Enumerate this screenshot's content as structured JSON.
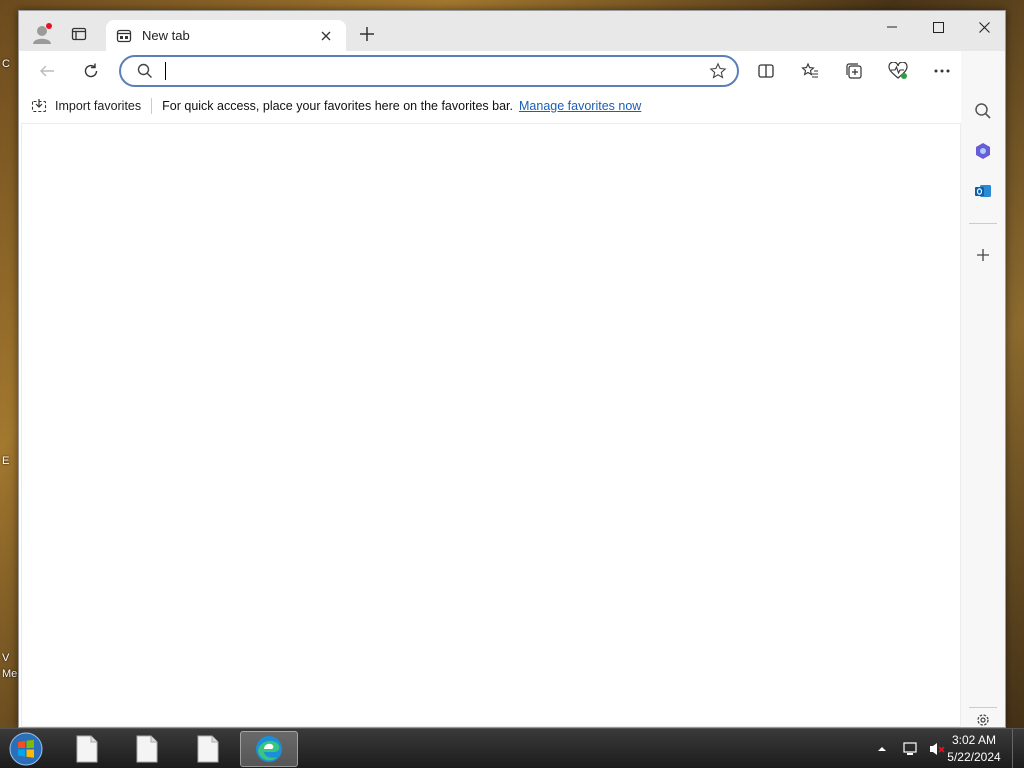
{
  "desktop": {
    "labels": [
      "C",
      "E",
      "V",
      "Me"
    ]
  },
  "browser": {
    "tab": {
      "title": "New tab"
    },
    "address_bar": {
      "value": "",
      "placeholder": ""
    },
    "favorites_bar": {
      "import_label": "Import favorites",
      "message": "For quick access, place your favorites here on the favorites bar.",
      "manage_link": "Manage favorites now"
    },
    "icons": {
      "profile": "profile-icon",
      "tab_actions": "tab-actions-icon",
      "new_tab": "plus-icon",
      "back": "back-arrow-icon",
      "refresh": "refresh-icon",
      "search": "search-icon",
      "favorite": "star-icon",
      "split_screen": "split-screen-icon",
      "favorites": "favorites-icon",
      "collections": "collections-icon",
      "performance": "heartbeat-icon",
      "more": "more-icon",
      "copilot": "copilot-icon"
    },
    "sidebar": [
      "search-icon",
      "copilot-app-icon",
      "outlook-icon",
      "add-icon",
      "settings-icon"
    ]
  },
  "colors": {
    "accent": "#1a5fb4",
    "address_border": "#5b7fb8",
    "titlebar": "#e8e8e8",
    "notification_dot": "#e81123"
  },
  "taskbar": {
    "clock_time": "3:02 AM",
    "clock_date": "5/22/2024",
    "items": [
      "file-icon",
      "file-icon",
      "file-icon",
      "edge-icon"
    ]
  }
}
